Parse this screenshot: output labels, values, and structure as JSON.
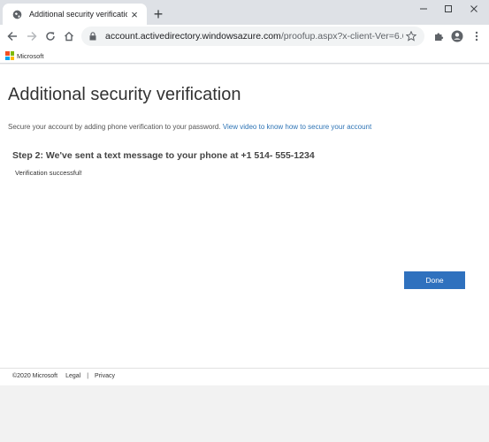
{
  "browser": {
    "tab_title": "Additional security verification",
    "url_host": "account.activedirectory.windowsazure.com",
    "url_path": "/proofup.aspx?x-client-Ver=6.6.0.0&x..."
  },
  "bookmarks": {
    "brand": "Microsoft"
  },
  "page": {
    "title": "Additional security verification",
    "intro_text": "Secure your account by adding phone verification to your password.",
    "intro_link": "View video to know how to secure your account",
    "step_heading": "Step 2: We've sent a text message to your phone at +1 514-  555-1234",
    "status_message": "Verification successful!",
    "done_label": "Done"
  },
  "footer": {
    "copyright": "©2020 Microsoft",
    "legal": "Legal",
    "separator": "|",
    "privacy": "Privacy"
  },
  "colors": {
    "accent": "#2f71be",
    "link": "#2e74b5"
  }
}
